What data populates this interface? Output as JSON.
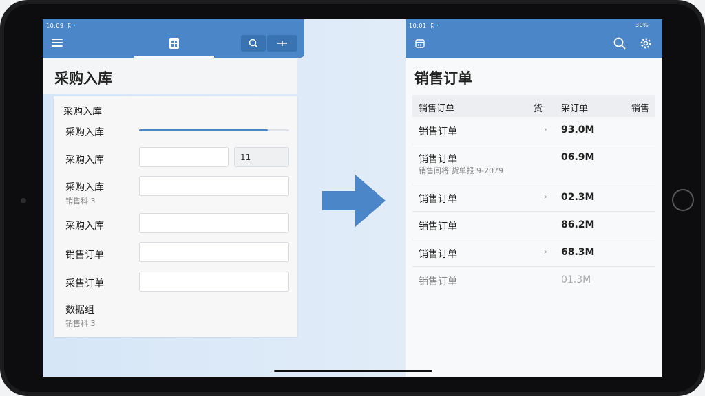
{
  "left": {
    "status_text": "10:09 卡 ·",
    "title": "采购入库",
    "form": {
      "section_title": "采购入库",
      "progress": 0.86,
      "quantity_value": "11",
      "rows": [
        {
          "label": "采购入库"
        },
        {
          "label": "采购入库"
        },
        {
          "label": "采购入库",
          "sub": "销售科 3"
        },
        {
          "label": "采购入库"
        },
        {
          "label": "销售订单"
        },
        {
          "label": "采售订单"
        },
        {
          "label": "数据组",
          "sub": "销售科 3"
        }
      ]
    }
  },
  "right": {
    "status_text": "10:01 卡 ·",
    "battery_text": "30%",
    "title": "销售订单",
    "table": {
      "headers": [
        "销售订单",
        "货",
        "采订单",
        "销售"
      ],
      "rows": [
        {
          "name": "销售订单",
          "sub": "",
          "chev": "›",
          "value": "93.0M"
        },
        {
          "name": "销售订单",
          "sub": "销售间将 货单报 9-2079",
          "chev": "",
          "value": "06.9M"
        },
        {
          "name": "销售订单",
          "sub": "",
          "chev": "›",
          "value": "02.3M"
        },
        {
          "name": "销售订单",
          "sub": "",
          "chev": "",
          "value": "86.2M"
        },
        {
          "name": "销售订单",
          "sub": "",
          "chev": "›",
          "value": "68.3M"
        },
        {
          "name": "销售订单",
          "sub": "",
          "chev": "",
          "value": "01.3M"
        }
      ]
    }
  },
  "icons": {
    "menu": "hamburger-icon",
    "document": "document-icon",
    "search": "search-icon",
    "more": "more-icon",
    "calendar": "calendar-icon",
    "settings": "gear-icon",
    "arrow": "arrow-right-icon"
  },
  "colors": {
    "accent": "#4a86c8",
    "accent_dark": "#3a73b2",
    "arrow": "#4a86c8"
  }
}
